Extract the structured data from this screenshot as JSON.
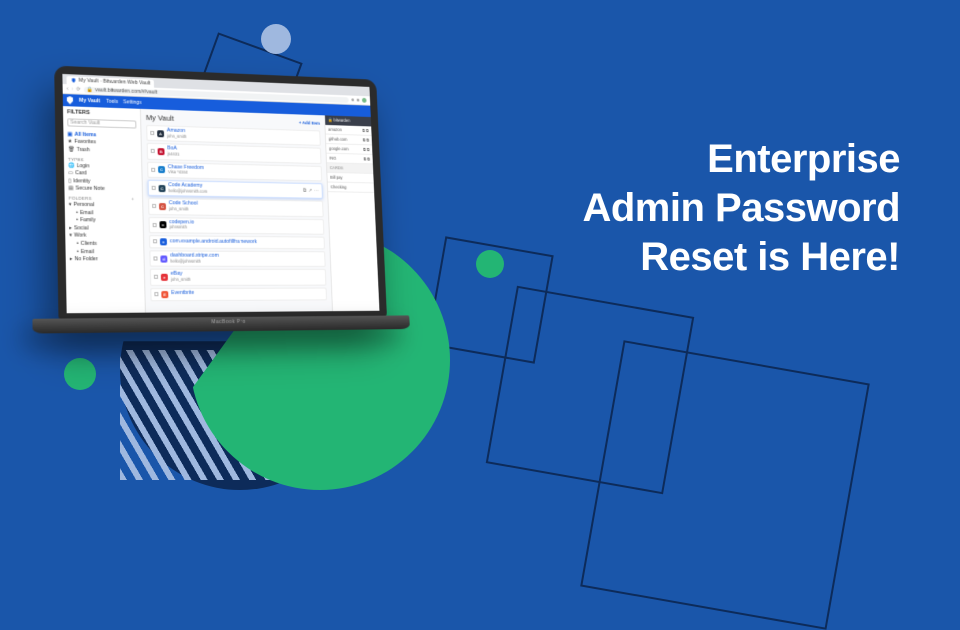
{
  "headline": {
    "line1": "Enterprise",
    "line2": "Admin Password",
    "line3": "Reset is Here!"
  },
  "laptop_label": "MacBook Pro",
  "browser": {
    "tab_title": "My Vault · Bitwarden Web Vault",
    "url": "vault.bitwarden.com/#/vault"
  },
  "app": {
    "brand": "My Vault",
    "nav": [
      "Tools",
      "Settings"
    ]
  },
  "sidebar": {
    "filters_label": "FILTERS",
    "search_placeholder": "Search Vault",
    "groups": {
      "main": [
        {
          "label": "All Items",
          "active": true
        },
        {
          "label": "Favorites"
        },
        {
          "label": "Trash"
        }
      ],
      "types_label": "TYPES",
      "types": [
        {
          "label": "Login"
        },
        {
          "label": "Card"
        },
        {
          "label": "Identity"
        },
        {
          "label": "Secure Note"
        }
      ],
      "folders_label": "FOLDERS",
      "folders": [
        {
          "label": "Personal",
          "children": [
            {
              "label": "Email"
            },
            {
              "label": "Family"
            }
          ]
        },
        {
          "label": "Social"
        },
        {
          "label": "Work",
          "children": [
            {
              "label": "Clients"
            },
            {
              "label": "Email"
            }
          ]
        },
        {
          "label": "No Folder"
        }
      ]
    }
  },
  "content": {
    "title": "My Vault",
    "add_label": "+ Add Item",
    "items": [
      {
        "name": "Amazon",
        "sub": "john_smith",
        "color": "#232f3e"
      },
      {
        "name": "BoA",
        "sub": "js4431",
        "color": "#c41230"
      },
      {
        "name": "Chase Freedom",
        "sub": "Visa *4344",
        "color": "#117aca"
      },
      {
        "name": "Code Academy",
        "sub": "hello@johnsmith.com",
        "color": "#1f4056",
        "selected": true
      },
      {
        "name": "Code School",
        "sub": "john_smith",
        "color": "#d34f3e"
      },
      {
        "name": "codepen.io",
        "sub": "johnsmith",
        "color": "#000"
      },
      {
        "name": "com.example.android.autofillframework",
        "sub": "",
        "color": "#175DDC"
      },
      {
        "name": "dashboard.stripe.com",
        "sub": "hello@johnsmith",
        "color": "#635bff"
      },
      {
        "name": "eBay",
        "sub": "john_smith",
        "color": "#e53238"
      },
      {
        "name": "Eventbrite",
        "sub": "",
        "color": "#f05537"
      }
    ]
  },
  "side_panel": {
    "head": "🔒 bitwarden",
    "rows": [
      {
        "l": "amazon",
        "r": "⧉ ⧉"
      },
      {
        "l": "github.com",
        "r": "⧉ ⧉"
      },
      {
        "l": "google.com",
        "r": "⧉ ⧉"
      },
      {
        "l": "ING",
        "r": "⧉ ⧉"
      }
    ],
    "section": "CARDS",
    "card_rows": [
      {
        "l": "Bill pay",
        "r": ""
      },
      {
        "l": "Checking",
        "r": ""
      }
    ]
  }
}
